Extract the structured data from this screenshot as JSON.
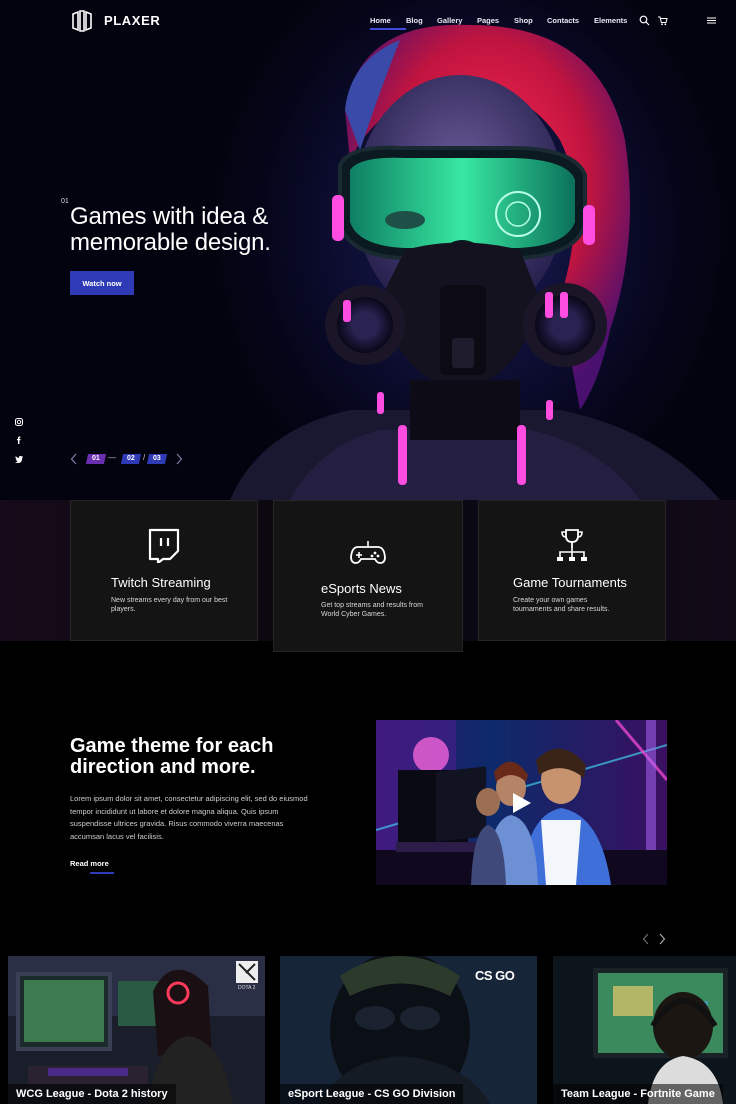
{
  "brand": {
    "name": "PLAXER"
  },
  "nav": {
    "items": [
      {
        "label": "Home",
        "active": true
      },
      {
        "label": "Blog"
      },
      {
        "label": "Gallery"
      },
      {
        "label": "Pages"
      },
      {
        "label": "Shop"
      },
      {
        "label": "Contacts"
      },
      {
        "label": "Elements"
      }
    ],
    "icons": [
      "search-icon",
      "cart-icon",
      "menu-icon"
    ]
  },
  "hero": {
    "slide_number": "01",
    "title_line1": "Games with idea &",
    "title_line2": "memorable design.",
    "button": "Watch now",
    "pager": [
      "01",
      "02",
      "03"
    ],
    "pager_separators": [
      "—",
      "/"
    ]
  },
  "social": [
    "instagram-icon",
    "facebook-icon",
    "twitter-icon"
  ],
  "features": [
    {
      "title": "Twitch Streaming",
      "text": "New streams every day from our best players.",
      "icon": "twitch-icon"
    },
    {
      "title": "eSports News",
      "text": "Get top streams and results from World Cyber Games.",
      "icon": "gamepad-icon"
    },
    {
      "title": "Game Tournaments",
      "text": "Create your own games tournaments and share results.",
      "icon": "trophy-icon"
    }
  ],
  "about": {
    "title_line1": "Game theme for each",
    "title_line2": "direction and more.",
    "text": "Lorem ipsum dolor sit amet, consectetur adipiscing elit, sed do eiusmod tempor incididunt ut labore et dolore magna aliqua. Quis ipsum suspendisse ultrices gravida. Risus commodo viverra maecenas accumsan lacus vel facilisis.",
    "link": "Read more"
  },
  "games": [
    {
      "label": "WCG League - Dota 2 history",
      "badge": "DOTA 2"
    },
    {
      "label": "eSport League - CS GO Division",
      "badge": "CS GO"
    },
    {
      "label": "Team League - Fortnite Game",
      "badge": ""
    }
  ],
  "colors": {
    "accent": "#2f3ab6",
    "accent_purple": "#6a2fb0",
    "neon_green": "#3dffb0",
    "neon_pink": "#ff4de1"
  }
}
